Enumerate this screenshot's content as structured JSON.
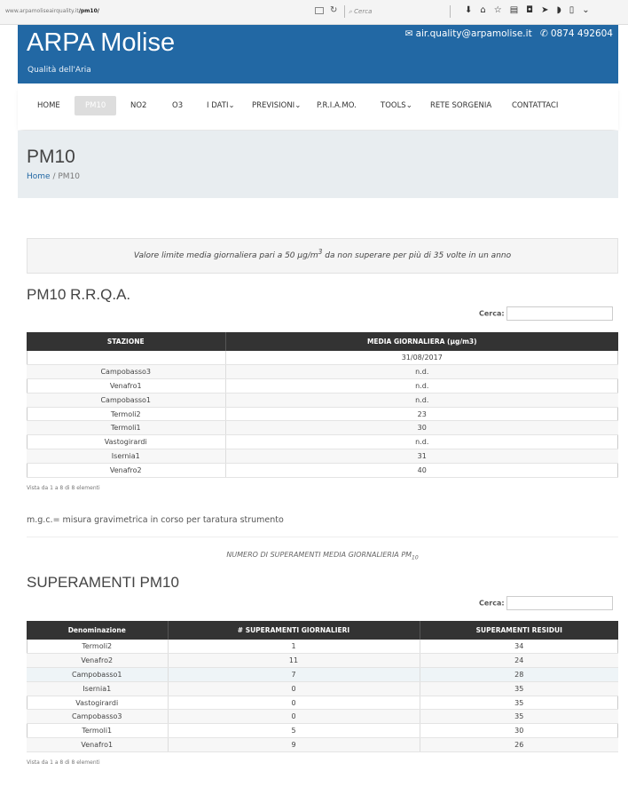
{
  "browser": {
    "url_host": "www.arpamoliseairquality.it",
    "url_path": "/pm10/",
    "search_placeholder": "Cerca"
  },
  "header": {
    "brand": "ARPA Molise",
    "tagline": "Qualità dell'Aria",
    "email": "air.quality@arpamolise.it",
    "phone": "0874 492604"
  },
  "nav": {
    "items": [
      "HOME",
      "PM10",
      "NO2",
      "O3",
      "I DATI",
      "PREVISIONI",
      "P.R.I.A.MO.",
      "TOOLS",
      "RETE SORGENIA",
      "CONTATTACI"
    ],
    "active": "PM10",
    "dropdown_mark": "⌄"
  },
  "title_band": {
    "title": "PM10",
    "breadcrumb_home": "Home",
    "breadcrumb_sep": "/",
    "breadcrumb_current": "PM10"
  },
  "alert": {
    "text_before": "Valore limite media giornaliera pari a 50 μg/m",
    "sup": "3",
    "text_after": " da non superare per più di 35 volte in un anno"
  },
  "rrqa": {
    "title": "PM10 R.R.Q.A.",
    "search_label": "Cerca:",
    "headers": [
      "STAZIONE",
      "MEDIA GIORNALIERA (μg/m3)"
    ],
    "date": "31/08/2017",
    "rows": [
      [
        "Campobasso3",
        "n.d."
      ],
      [
        "Venafro1",
        "n.d."
      ],
      [
        "Campobasso1",
        "n.d."
      ],
      [
        "Termoli2",
        "23"
      ],
      [
        "Termoli1",
        "30"
      ],
      [
        "Vastogirardi",
        "n.d."
      ],
      [
        "Isernia1",
        "31"
      ],
      [
        "Venafro2",
        "40"
      ]
    ],
    "info": "Vista da 1 a 8 di 8 elementi"
  },
  "note": "m.g.c.= misura gravimetrica in corso per taratura strumento",
  "caption": {
    "text": "NUMERO DI SUPERAMENTI MEDIA GIORNALIERIA PM",
    "sub": "10"
  },
  "superamenti": {
    "title": "SUPERAMENTI PM10",
    "search_label": "Cerca:",
    "headers": [
      "Denominazione",
      "# SUPERAMENTI GIORNALIERI",
      "SUPERAMENTI RESIDUI"
    ],
    "rows": [
      [
        "Termoli2",
        "1",
        "34"
      ],
      [
        "Venafro2",
        "11",
        "24"
      ],
      [
        "Campobasso1",
        "7",
        "28"
      ],
      [
        "Isernia1",
        "0",
        "35"
      ],
      [
        "Vastogirardi",
        "0",
        "35"
      ],
      [
        "Campobasso3",
        "0",
        "35"
      ],
      [
        "Termoli1",
        "5",
        "30"
      ],
      [
        "Venafro1",
        "9",
        "26"
      ]
    ],
    "info": "Vista da 1 a 8 di 8 elementi"
  },
  "colors": {
    "header_bg": "#2268a4",
    "table_header_bg": "#333333"
  }
}
